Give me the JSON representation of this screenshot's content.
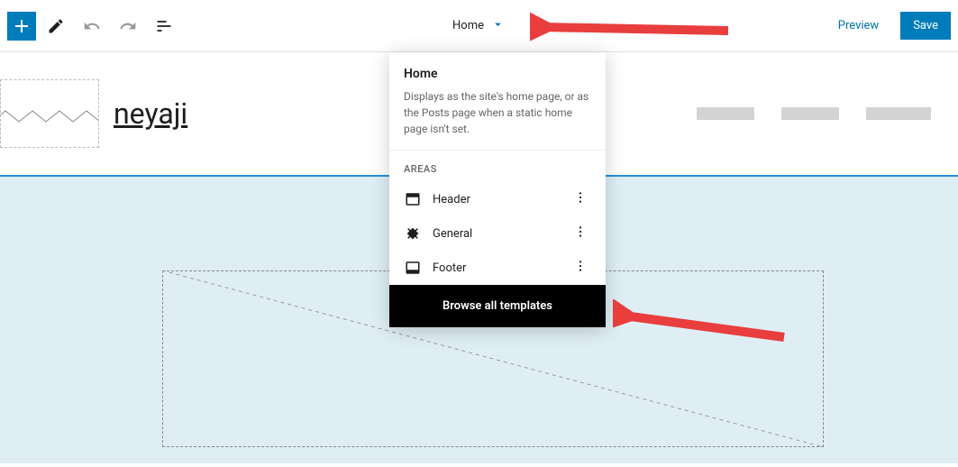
{
  "toolbar": {
    "template_name": "Home",
    "preview_label": "Preview",
    "save_label": "Save"
  },
  "site": {
    "title": "neyaji"
  },
  "popover": {
    "title": "Home",
    "description": "Displays as the site's home page, or as the Posts page when a static home page isn't set.",
    "section_label": "Areas",
    "areas": [
      {
        "label": "Header"
      },
      {
        "label": "General"
      },
      {
        "label": "Footer"
      }
    ],
    "browse_label": "Browse all templates"
  }
}
